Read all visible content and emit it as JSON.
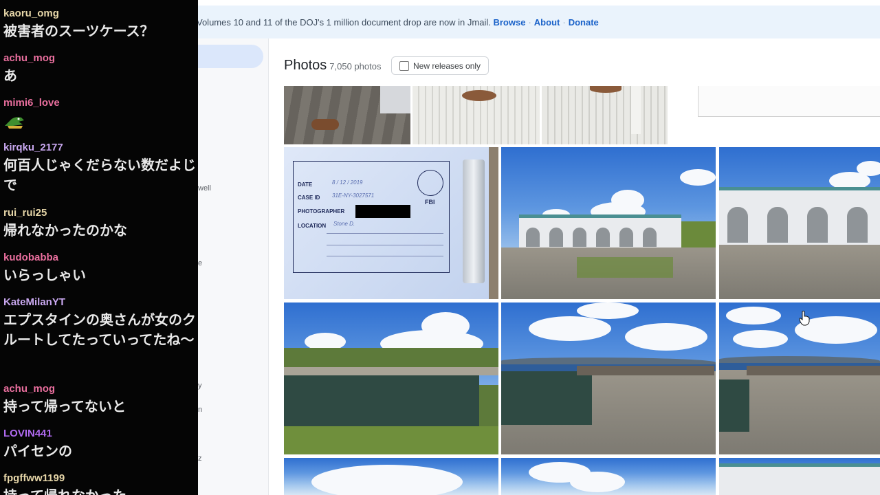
{
  "banner": {
    "text": "Volumes 10 and 11 of the DOJ's 1 million document drop are now in Jmail.",
    "links": [
      "Browse",
      "About",
      "Donate"
    ],
    "separator": "·"
  },
  "sidebar": {
    "fragments": [
      "well",
      "e",
      "y",
      "n",
      "z"
    ]
  },
  "photos": {
    "title": "Photos",
    "count": "7,050 photos",
    "filter_label": "New releases only",
    "filter_checked": false
  },
  "form_card": {
    "date_label": "DATE",
    "date_value": "8 / 12 / 2019",
    "case_label": "CASE ID",
    "case_value": "31E-NY-3027571",
    "photographer_label": "PHOTOGRAPHER",
    "location_label": "LOCATION",
    "location_value": "Stone D.",
    "seal_text": "FBI"
  },
  "chat": {
    "messages": [
      {
        "user": "kaoru_omg",
        "text": "被害者のスーツケース？",
        "color": "#e6d6a8"
      },
      {
        "user": "achu_mog",
        "text": "あ",
        "color": "#ea6f9e"
      },
      {
        "user": "mimi6_love",
        "text": "",
        "emote": "alligator",
        "color": "#ea6f9e"
      },
      {
        "user": "kirqku_2177",
        "text": "何百人じゃくだらない数だよじで",
        "color": "#c9a8f0"
      },
      {
        "user": "rui_rui25",
        "text": "帰れなかったのかな",
        "color": "#e6d6a8"
      },
      {
        "user": "kudobabba",
        "text": "いらっしゃい",
        "color": "#ea6f9e"
      },
      {
        "user": "KateMilanYT",
        "text": "エプスタインの奥さんが女のクルートしてたっていってたね～",
        "color": "#c9a8f0"
      },
      {
        "user": "achu_mog",
        "text": "持って帰ってないと",
        "color": "#ea6f9e"
      },
      {
        "user": "LOVIN441",
        "text": "パイセンの",
        "color": "#b06af0"
      },
      {
        "user": "fpgffww1199",
        "text": "持って帰れなかった",
        "color": "#e6d6a8"
      }
    ]
  }
}
